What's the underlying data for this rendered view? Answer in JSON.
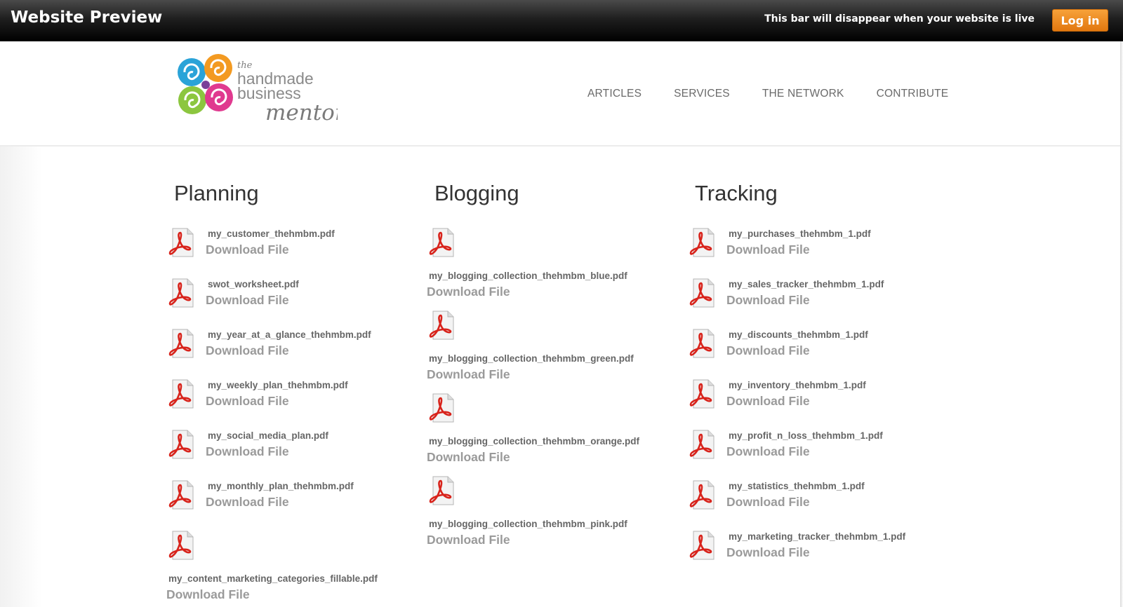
{
  "preview_bar": {
    "title": "Website Preview",
    "note": "This bar will disappear when your website is live",
    "login_label": "Log in"
  },
  "logo": {
    "line1": "the",
    "line2": "handmade",
    "line3": "business",
    "line4": "mentor"
  },
  "nav": {
    "items": [
      {
        "label": "ARTICLES"
      },
      {
        "label": "SERVICES"
      },
      {
        "label": "THE NETWORK"
      },
      {
        "label": "CONTRIBUTE"
      }
    ]
  },
  "columns": [
    {
      "title": "Planning",
      "files": [
        {
          "name": "my_customer_thehmbm.pdf",
          "download": "Download File"
        },
        {
          "name": "swot_worksheet.pdf",
          "download": "Download File"
        },
        {
          "name": "my_year_at_a_glance_thehmbm.pdf",
          "download": "Download File"
        },
        {
          "name": "my_weekly_plan_thehmbm.pdf",
          "download": "Download File"
        },
        {
          "name": "my_social_media_plan.pdf",
          "download": "Download File"
        },
        {
          "name": "my_monthly_plan_thehmbm.pdf",
          "download": "Download File"
        },
        {
          "name": "my_content_marketing_categories_fillable.pdf",
          "download": "Download File"
        }
      ]
    },
    {
      "title": "Blogging",
      "files": [
        {
          "name": "my_blogging_collection_thehmbm_blue.pdf",
          "download": "Download File"
        },
        {
          "name": "my_blogging_collection_thehmbm_green.pdf",
          "download": "Download File"
        },
        {
          "name": "my_blogging_collection_thehmbm_orange.pdf",
          "download": "Download File"
        },
        {
          "name": "my_blogging_collection_thehmbm_pink.pdf",
          "download": "Download File"
        }
      ]
    },
    {
      "title": "Tracking",
      "files": [
        {
          "name": "my_purchases_thehmbm_1.pdf",
          "download": "Download File"
        },
        {
          "name": "my_sales_tracker_thehmbm_1.pdf",
          "download": "Download File"
        },
        {
          "name": "my_discounts_thehmbm_1.pdf",
          "download": "Download File"
        },
        {
          "name": "my_inventory_thehmbm_1.pdf",
          "download": "Download File"
        },
        {
          "name": "my_profit_n_loss_thehmbm_1.pdf",
          "download": "Download File"
        },
        {
          "name": "my_statistics_thehmbm_1.pdf",
          "download": "Download File"
        },
        {
          "name": "my_marketing_tracker_thehmbm_1.pdf",
          "download": "Download File"
        }
      ]
    }
  ]
}
